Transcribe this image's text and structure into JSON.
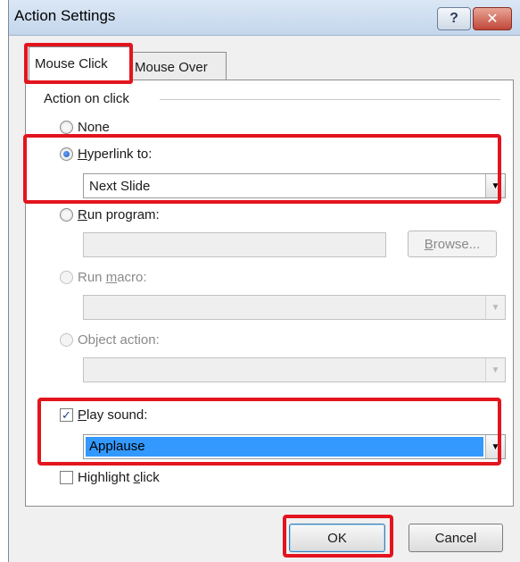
{
  "window": {
    "title": "Action Settings",
    "help_label": "?",
    "close_label": "✕"
  },
  "tabs": [
    {
      "label": "Mouse Click",
      "active": true
    },
    {
      "label": "Mouse Over",
      "active": false
    }
  ],
  "group": {
    "label": "Action on click"
  },
  "options": {
    "none": {
      "label": "None",
      "checked": false
    },
    "hyperlink": {
      "label_prefix": "",
      "mnemonic": "H",
      "label_rest": "yperlink to:",
      "checked": true,
      "value": "Next Slide"
    },
    "run_program": {
      "mnemonic": "R",
      "label_rest": "un program:",
      "value": "",
      "browse_prefix": "",
      "browse_mnemonic": "B",
      "browse_rest": "rowse..."
    },
    "run_macro": {
      "label_prefix": "Run ",
      "mnemonic": "m",
      "label_rest": "acro:",
      "value": ""
    },
    "object_action": {
      "label": "Object action:",
      "value": ""
    }
  },
  "play_sound": {
    "mnemonic": "P",
    "label_rest": "lay sound:",
    "checked": true,
    "value": "Applause"
  },
  "highlight_click": {
    "label_prefix": "Highlight ",
    "mnemonic": "c",
    "label_rest": "lick",
    "checked": false
  },
  "buttons": {
    "ok": "OK",
    "cancel": "Cancel"
  },
  "colors": {
    "highlight_box": "#e3141e",
    "selection": "#3399ff"
  },
  "icons": {
    "dropdown": "▼",
    "checkmark": "✓"
  }
}
